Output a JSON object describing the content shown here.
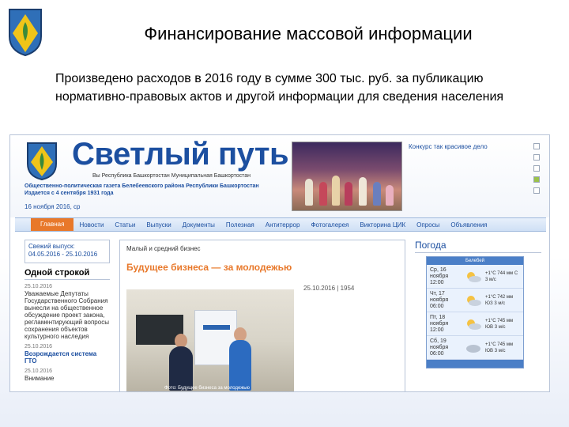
{
  "slide": {
    "title": "Финансирование массовой информации",
    "body": "Произведено расходов в 2016 году в сумме 300 тыс. руб. за публикацию нормативно-правовых актов и другой информации для сведения населения"
  },
  "site": {
    "logo": "Светлый путь",
    "tagline": "Вы Республика Башкортостан Муниципальная Башкортостан",
    "subtitle_line1": "Общественно-политическая газета Белебеевского района Республики Башкортостан",
    "subtitle_line2": "Издается с 4 сентября 1931 года",
    "date": "16 ноября 2016, ср",
    "header_news": "Конкурс так красивое дело"
  },
  "nav": {
    "items": [
      "Главная",
      "Новости",
      "Статьи",
      "Выпуски",
      "Документы",
      "Полезная",
      "Антитеррор",
      "Фотогалерея",
      "Викторина ЦИК",
      "Опросы",
      "Объявления"
    ]
  },
  "left": {
    "issue_label": "Свежий выпуск:",
    "issue_dates": "04.05.2016 - 25.10.2016",
    "one_line_heading": "Одной строкой",
    "items": [
      {
        "date": "25.10.2016",
        "text": "Уважаемые Депутаты Государственного Собрания вынесли на общественное обсуждение проект закона, регламентирующий вопросы сохранения объектов культурного наследия"
      },
      {
        "date": "25.10.2016",
        "text": "Возрождается система ГТО"
      },
      {
        "date": "25.10.2016",
        "text": "Внимание"
      }
    ]
  },
  "main": {
    "section": "Малый и средний бизнес",
    "article_title": "Будущее бизнеса — за молодежью",
    "article_date": "25.10.2016 | 1954",
    "photo_caption": "Фото: Будущее бизнеса за молодежью"
  },
  "weather": {
    "title": "Погода",
    "widget_head": "Белебей",
    "rows": [
      {
        "day": "Ср, 16 ноября",
        "time": "12:00",
        "vals": "+1°C 744 мм С 3 м/с",
        "icon": "cloud-sun-icon"
      },
      {
        "day": "Чт, 17 ноября",
        "time": "06:00",
        "vals": "+1°C 742 мм ЮЗ 3 м/с",
        "icon": "cloud-sun-icon"
      },
      {
        "day": "Пт, 18 ноября",
        "time": "12:00",
        "vals": "+1°C 745 мм ЮВ 3 м/с",
        "icon": "cloud-sun-icon"
      },
      {
        "day": "Сб, 19 ноября",
        "time": "06:00",
        "vals": "+1°C 745 мм ЮВ 3 м/с",
        "icon": "cloud-icon"
      }
    ]
  },
  "colors": {
    "brand_blue": "#1c4fa0",
    "accent_orange": "#e8782a"
  }
}
